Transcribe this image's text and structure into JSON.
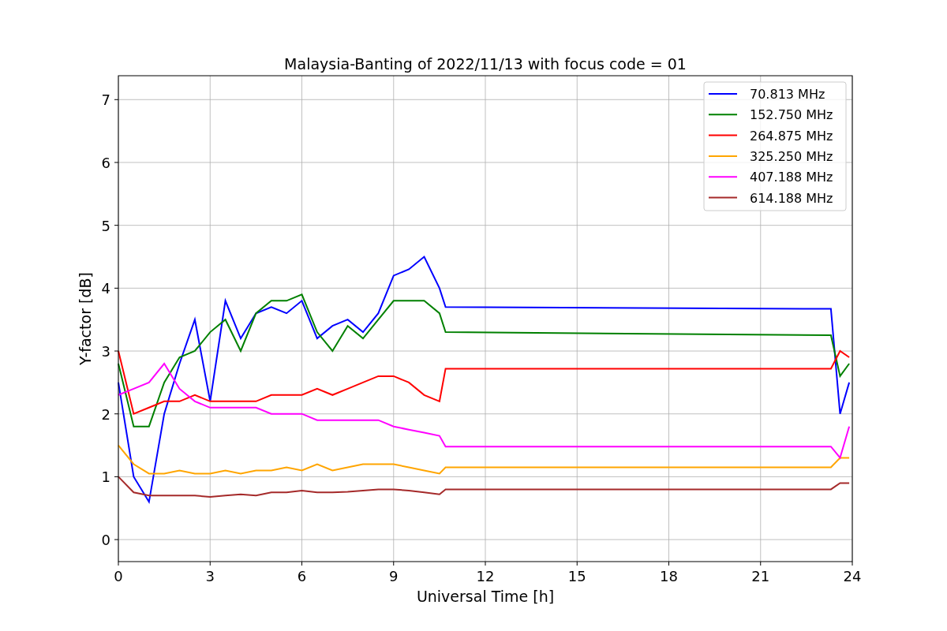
{
  "figure": {
    "chart_data": {
      "type": "line",
      "title": "Malaysia-Banting of 2022/11/13 with focus code = 01",
      "xlabel": "Universal Time [h]",
      "ylabel": "Y-factor [dB]",
      "x": [
        0,
        0.5,
        1,
        1.5,
        2,
        2.5,
        3,
        3.5,
        4,
        4.5,
        5,
        5.5,
        6,
        6.5,
        7,
        7.5,
        8,
        8.5,
        9,
        9.5,
        10,
        10.5,
        10.7,
        23.3,
        23.6,
        23.9
      ],
      "series": [
        {
          "name": "70.813 MHz",
          "color": "#0000ff",
          "values": [
            2.5,
            1.0,
            0.6,
            2.0,
            2.8,
            3.5,
            2.2,
            3.8,
            3.2,
            3.6,
            3.7,
            3.6,
            3.8,
            3.2,
            3.4,
            3.5,
            3.3,
            3.6,
            4.2,
            4.3,
            4.5,
            4.0,
            3.7,
            3.67,
            2.0,
            2.5
          ]
        },
        {
          "name": "152.750 MHz",
          "color": "#008000",
          "values": [
            2.8,
            1.8,
            1.8,
            2.5,
            2.9,
            3.0,
            3.3,
            3.5,
            3.0,
            3.6,
            3.8,
            3.8,
            3.9,
            3.3,
            3.0,
            3.4,
            3.2,
            3.5,
            3.8,
            3.8,
            3.8,
            3.6,
            3.3,
            3.25,
            2.6,
            2.8
          ]
        },
        {
          "name": "264.875 MHz",
          "color": "#ff0000",
          "values": [
            3.0,
            2.0,
            2.1,
            2.2,
            2.2,
            2.3,
            2.2,
            2.2,
            2.2,
            2.2,
            2.3,
            2.3,
            2.3,
            2.4,
            2.3,
            2.4,
            2.5,
            2.6,
            2.6,
            2.5,
            2.3,
            2.2,
            2.72,
            2.72,
            3.0,
            2.9
          ]
        },
        {
          "name": "325.250 MHz",
          "color": "#ffa500",
          "values": [
            1.5,
            1.2,
            1.05,
            1.05,
            1.1,
            1.05,
            1.05,
            1.1,
            1.05,
            1.1,
            1.1,
            1.15,
            1.1,
            1.2,
            1.1,
            1.15,
            1.2,
            1.2,
            1.2,
            1.15,
            1.1,
            1.05,
            1.15,
            1.15,
            1.3,
            1.3
          ]
        },
        {
          "name": "407.188 MHz",
          "color": "#ff00ff",
          "values": [
            2.3,
            2.4,
            2.5,
            2.8,
            2.4,
            2.2,
            2.1,
            2.1,
            2.1,
            2.1,
            2.0,
            2.0,
            2.0,
            1.9,
            1.9,
            1.9,
            1.9,
            1.9,
            1.8,
            1.75,
            1.7,
            1.65,
            1.48,
            1.48,
            1.3,
            1.8
          ]
        },
        {
          "name": "614.188 MHz",
          "color": "#a52a2a",
          "values": [
            1.0,
            0.75,
            0.7,
            0.7,
            0.7,
            0.7,
            0.68,
            0.7,
            0.72,
            0.7,
            0.75,
            0.75,
            0.78,
            0.75,
            0.75,
            0.76,
            0.78,
            0.8,
            0.8,
            0.78,
            0.75,
            0.72,
            0.8,
            0.8,
            0.9,
            0.9
          ]
        }
      ],
      "xlim": [
        0,
        24
      ],
      "ylim": [
        -0.35,
        7.38
      ],
      "xticks": [
        0,
        3,
        6,
        9,
        12,
        15,
        18,
        21,
        24
      ],
      "yticks": [
        0,
        1,
        2,
        3,
        4,
        5,
        6,
        7
      ],
      "grid": true,
      "legend": true
    }
  }
}
